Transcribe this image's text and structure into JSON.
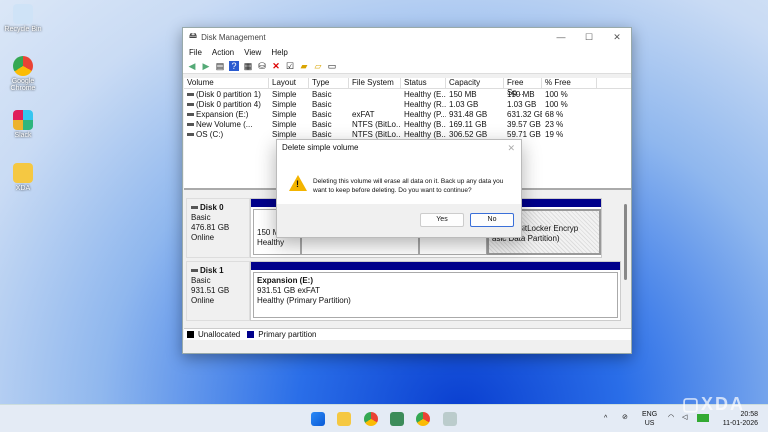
{
  "desktop": {
    "icons": [
      {
        "label": "Recycle Bin",
        "icon": "recycle-bin-icon"
      },
      {
        "label": "Google Chrome",
        "icon": "chrome-icon"
      },
      {
        "label": "Slack",
        "icon": "slack-icon"
      },
      {
        "label": "XDA",
        "icon": "folder-icon"
      }
    ]
  },
  "window": {
    "title": "Disk Management",
    "menu": [
      "File",
      "Action",
      "View",
      "Help"
    ],
    "columns": [
      "Volume",
      "Layout",
      "Type",
      "File System",
      "Status",
      "Capacity",
      "Free Sp...",
      "% Free"
    ],
    "rows": [
      [
        "(Disk 0 partition 1)",
        "Simple",
        "Basic",
        "",
        "Healthy (E...",
        "150 MB",
        "150 MB",
        "100 %"
      ],
      [
        "(Disk 0 partition 4)",
        "Simple",
        "Basic",
        "",
        "Healthy (R...",
        "1.03 GB",
        "1.03 GB",
        "100 %"
      ],
      [
        "Expansion (E:)",
        "Simple",
        "Basic",
        "exFAT",
        "Healthy (P...",
        "931.48 GB",
        "631.32 GB",
        "68 %"
      ],
      [
        "New Volume (...",
        "Simple",
        "Basic",
        "NTFS (BitLo...",
        "Healthy (B...",
        "169.11 GB",
        "39.57 GB",
        "23 %"
      ],
      [
        "OS (C:)",
        "Simple",
        "Basic",
        "NTFS (BitLo...",
        "Healthy (B...",
        "306.52 GB",
        "59.71 GB",
        "19 %"
      ]
    ],
    "disks": [
      {
        "name": "Disk 0",
        "type": "Basic",
        "size": "476.81 GB",
        "state": "Online",
        "p1": {
          "l1": "150 MB",
          "l2": "Healthy"
        },
        "p2": {
          "l1": "me  (D:)",
          "l2": "NTFS (BitLocker Encryp",
          "l3": "asic Data Partition)"
        }
      },
      {
        "name": "Disk 1",
        "type": "Basic",
        "size": "931.51 GB",
        "state": "Online",
        "p1": {
          "l1": "Expansion  (E:)",
          "l2": "931.51 GB exFAT",
          "l3": "Healthy (Primary Partition)"
        }
      }
    ],
    "legend": [
      "Unallocated",
      "Primary partition"
    ],
    "colors": {
      "unallocated": "#000000",
      "primary": "#00008b"
    }
  },
  "dialog": {
    "title": "Delete simple volume",
    "message": "Deleting this volume will erase all data on it. Back up any data you want to keep before deleting. Do you want to continue?",
    "yes": "Yes",
    "no": "No"
  },
  "taskbar": {
    "lang1": "ENG",
    "lang2": "US",
    "time": "20:58",
    "date": "11-01-2026"
  },
  "watermark": "XDA"
}
